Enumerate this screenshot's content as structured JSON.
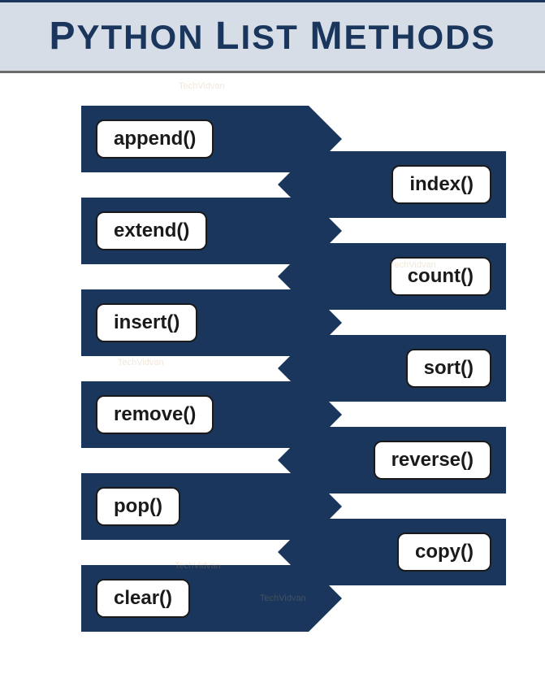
{
  "title": "PYTHON LIST METHODS",
  "left_methods": [
    "append()",
    "extend()",
    "insert()",
    "remove()",
    "pop()",
    "clear()"
  ],
  "right_methods": [
    "index()",
    "count()",
    "sort()",
    "reverse()",
    "copy()"
  ],
  "watermark_text": "TechVidvan"
}
